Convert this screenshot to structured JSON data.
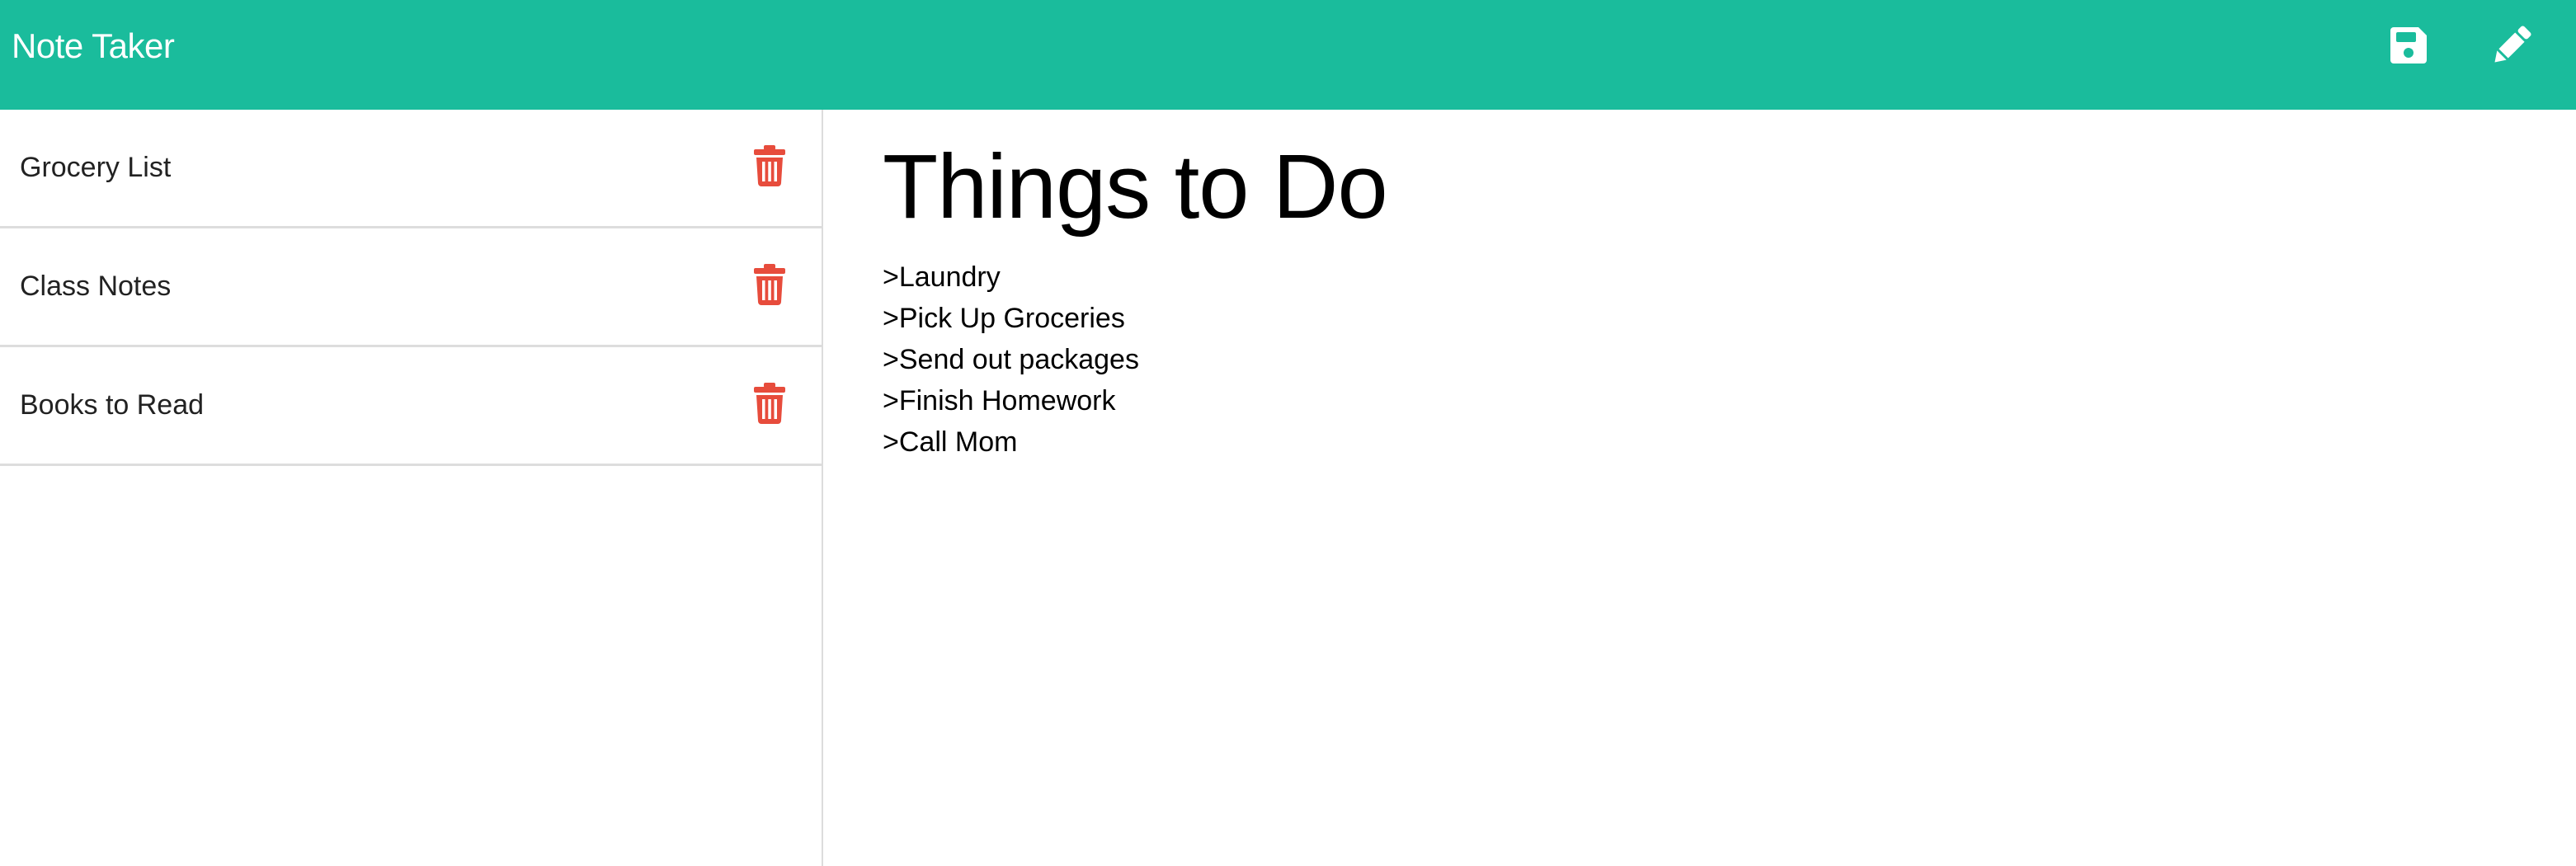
{
  "app": {
    "title": "Note Taker",
    "accent_color": "#1abc9c",
    "delete_color": "#e74c3c"
  },
  "navbar": {
    "save_icon": "floppy-disk-icon",
    "new_icon": "pencil-icon"
  },
  "sidebar": {
    "notes": [
      {
        "title": "Grocery List",
        "icon": "trash-icon"
      },
      {
        "title": "Class Notes",
        "icon": "trash-icon"
      },
      {
        "title": "Books to Read",
        "icon": "trash-icon"
      }
    ]
  },
  "active_note": {
    "title": "Things to Do",
    "lines": [
      ">Laundry",
      ">Pick Up Groceries",
      ">Send out packages",
      ">Finish Homework",
      ">Call Mom"
    ]
  }
}
